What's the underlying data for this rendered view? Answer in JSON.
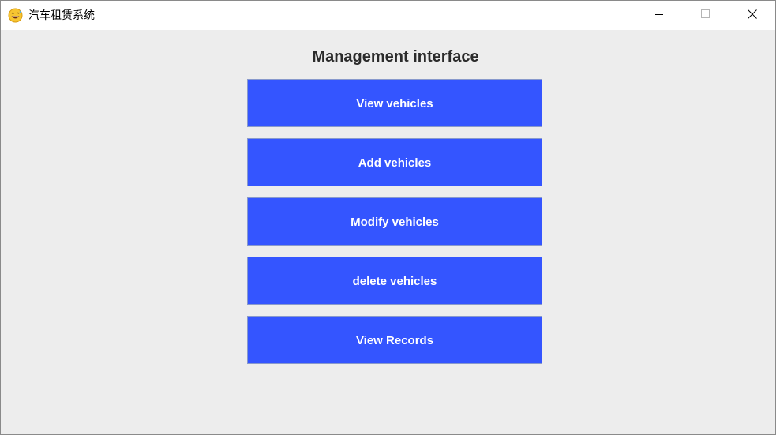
{
  "window": {
    "title": "汽车租赁系统",
    "app_icon": "grinning-sweat-emoji-icon",
    "controls": {
      "minimize_icon": "minimize-icon",
      "maximize_icon": "maximize-icon",
      "close_icon": "close-icon"
    }
  },
  "main": {
    "heading": "Management interface",
    "buttons": [
      {
        "label": "View vehicles"
      },
      {
        "label": "Add vehicles"
      },
      {
        "label": "Modify vehicles"
      },
      {
        "label": "delete vehicles"
      },
      {
        "label": "View Records"
      }
    ]
  },
  "colors": {
    "button_bg": "#3455ff",
    "button_text": "#ffffff",
    "content_bg": "#ededed",
    "heading_text": "#2b2b2b"
  }
}
